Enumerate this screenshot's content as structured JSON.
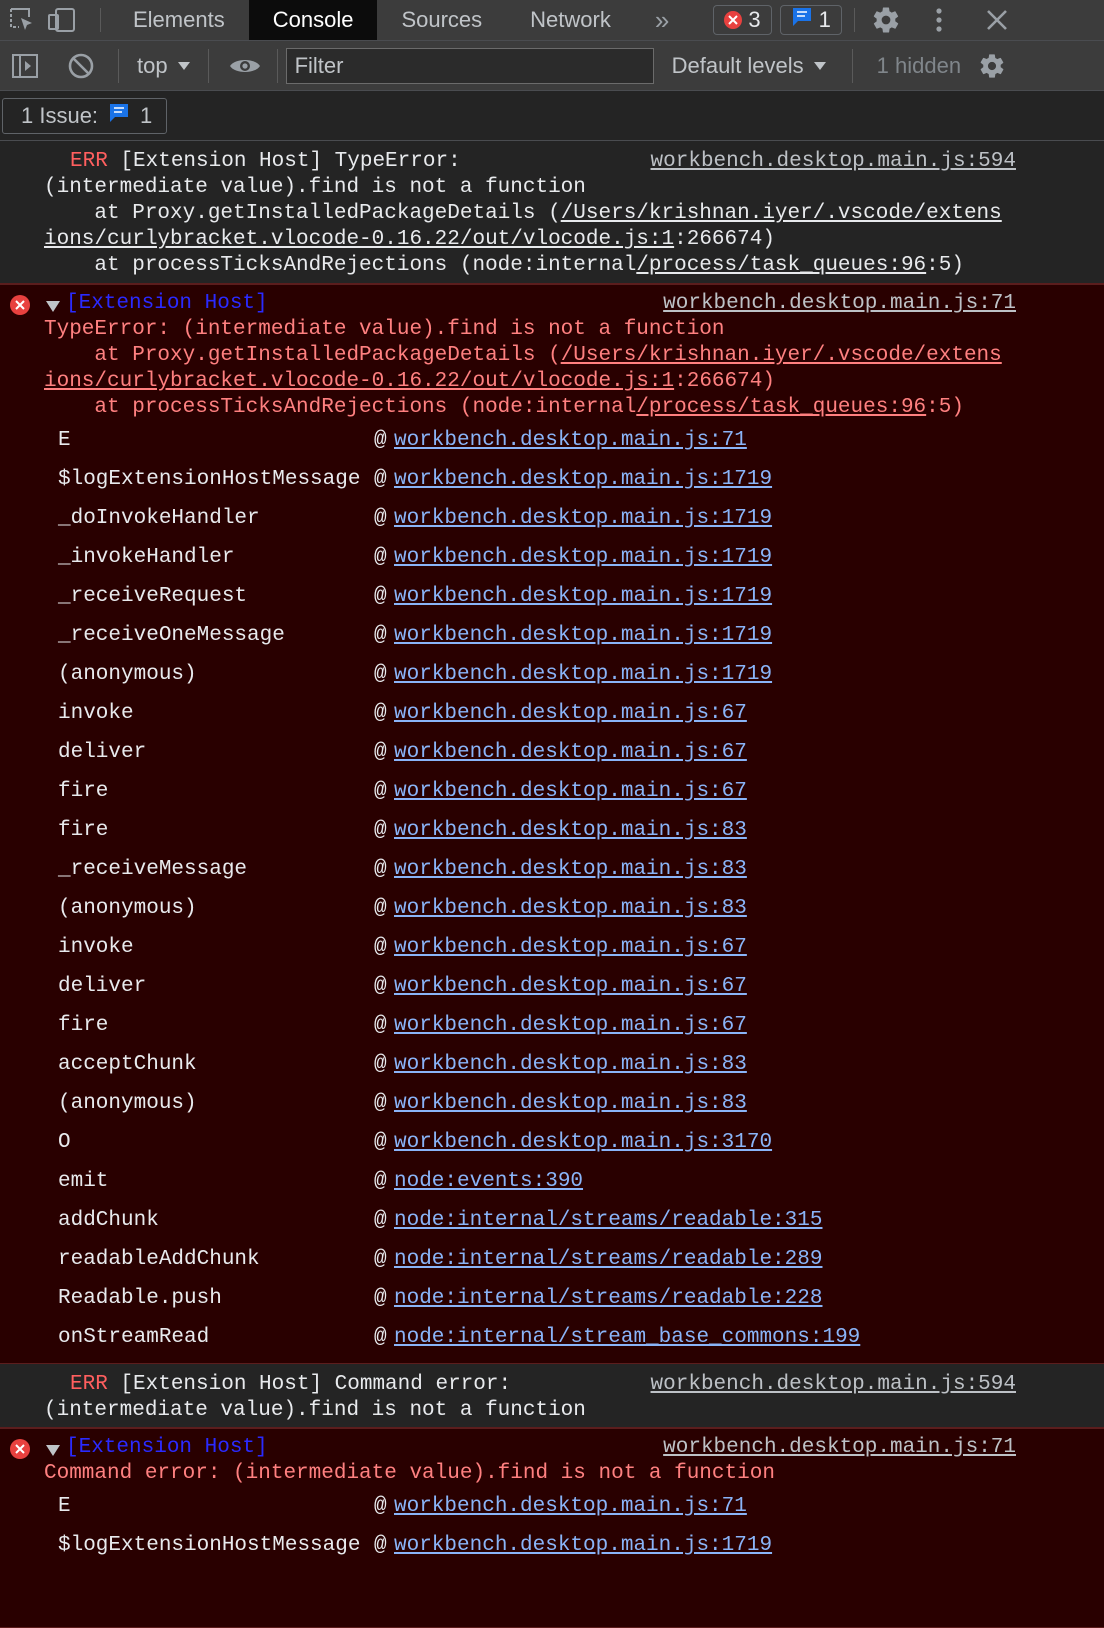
{
  "tabs": {
    "items": [
      "Elements",
      "Console",
      "Sources",
      "Network"
    ],
    "more": "»",
    "errors_count": "3",
    "messages_count": "1"
  },
  "toolbar": {
    "context": "top",
    "filter_placeholder": "Filter",
    "levels": "Default levels",
    "hidden": "1 hidden"
  },
  "issues": {
    "label": "1 Issue:",
    "count": "1"
  },
  "messages": {
    "m1": {
      "label": "ERR",
      "text": " [Extension Host] TypeError:",
      "line2": "(intermediate value).find is not a function",
      "line3_pre": "    at Proxy.getInstalledPackageDetails (",
      "line3_link": "/Users/krishnan.iyer/.vscode/extens",
      "line4_link": "ions/curlybracket.vlocode-0.16.22/out/vlocode.js:1",
      "line4_post": ":266674)",
      "line5_pre": "    at processTicksAndRejections (node:internal",
      "line5_link": "/process/task_queues:96",
      "line5_post": ":5)",
      "source": "workbench.desktop.main.js:594"
    },
    "m2": {
      "prefix": "[Extension Host]",
      "line1": "TypeError: (intermediate value).find is not a function",
      "line2_pre": "    at Proxy.getInstalledPackageDetails (",
      "line2_link": "/Users/krishnan.iyer/.vscode/extens",
      "line3_link": "ions/curlybracket.vlocode-0.16.22/out/vlocode.js:1",
      "line3_post": ":266674)",
      "line4_pre": "    at processTicksAndRejections (node:internal",
      "line4_link": "/process/task_queues:96",
      "line4_post": ":5)",
      "source": "workbench.desktop.main.js:71",
      "trace": [
        {
          "fn": "E",
          "link": "workbench.desktop.main.js:71"
        },
        {
          "fn": "$logExtensionHostMessage",
          "link": "workbench.desktop.main.js:1719"
        },
        {
          "fn": "_doInvokeHandler",
          "link": "workbench.desktop.main.js:1719"
        },
        {
          "fn": "_invokeHandler",
          "link": "workbench.desktop.main.js:1719"
        },
        {
          "fn": "_receiveRequest",
          "link": "workbench.desktop.main.js:1719"
        },
        {
          "fn": "_receiveOneMessage",
          "link": "workbench.desktop.main.js:1719"
        },
        {
          "fn": "(anonymous)",
          "link": "workbench.desktop.main.js:1719"
        },
        {
          "fn": "invoke",
          "link": "workbench.desktop.main.js:67"
        },
        {
          "fn": "deliver",
          "link": "workbench.desktop.main.js:67"
        },
        {
          "fn": "fire",
          "link": "workbench.desktop.main.js:67"
        },
        {
          "fn": "fire",
          "link": "workbench.desktop.main.js:83"
        },
        {
          "fn": "_receiveMessage",
          "link": "workbench.desktop.main.js:83"
        },
        {
          "fn": "(anonymous)",
          "link": "workbench.desktop.main.js:83"
        },
        {
          "fn": "invoke",
          "link": "workbench.desktop.main.js:67"
        },
        {
          "fn": "deliver",
          "link": "workbench.desktop.main.js:67"
        },
        {
          "fn": "fire",
          "link": "workbench.desktop.main.js:67"
        },
        {
          "fn": "acceptChunk",
          "link": "workbench.desktop.main.js:83"
        },
        {
          "fn": "(anonymous)",
          "link": "workbench.desktop.main.js:83"
        },
        {
          "fn": "O",
          "link": "workbench.desktop.main.js:3170"
        },
        {
          "fn": "emit",
          "link": "node:events:390"
        },
        {
          "fn": "addChunk",
          "link": "node:internal/streams/readable:315"
        },
        {
          "fn": "readableAddChunk",
          "link": "node:internal/streams/readable:289"
        },
        {
          "fn": "Readable.push",
          "link": "node:internal/streams/readable:228"
        },
        {
          "fn": "onStreamRead",
          "link": "node:internal/stream_base_commons:199"
        }
      ]
    },
    "m3": {
      "label": "ERR",
      "text": " [Extension Host] Command error:",
      "line2": "(intermediate value).find is not a function",
      "source": "workbench.desktop.main.js:594"
    },
    "m4": {
      "prefix": "[Extension Host]",
      "line1": "Command error: (intermediate value).find is not a function",
      "source": "workbench.desktop.main.js:71",
      "trace": [
        {
          "fn": "E",
          "link": "workbench.desktop.main.js:71"
        },
        {
          "fn": "$logExtensionHostMessage",
          "link": "workbench.desktop.main.js:1719"
        }
      ]
    }
  }
}
